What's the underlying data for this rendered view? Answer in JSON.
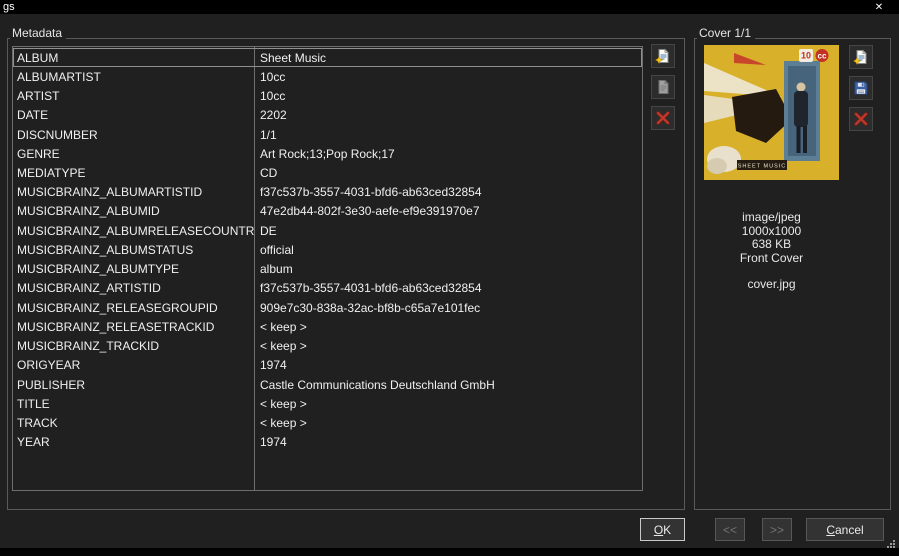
{
  "window": {
    "title": "gs",
    "close_icon": "✕"
  },
  "metadata": {
    "group_label": "Metadata",
    "rows": [
      {
        "field": "ALBUM",
        "value": "Sheet Music"
      },
      {
        "field": "ALBUMARTIST",
        "value": "10cc"
      },
      {
        "field": "ARTIST",
        "value": "10cc"
      },
      {
        "field": "DATE",
        "value": "2202"
      },
      {
        "field": "DISCNUMBER",
        "value": "1/1"
      },
      {
        "field": "GENRE",
        "value": "Art Rock;13;Pop Rock;17"
      },
      {
        "field": "MEDIATYPE",
        "value": "CD"
      },
      {
        "field": "MUSICBRAINZ_ALBUMARTISTID",
        "value": "f37c537b-3557-4031-bfd6-ab63ced32854"
      },
      {
        "field": "MUSICBRAINZ_ALBUMID",
        "value": "47e2db44-802f-3e30-aefe-ef9e391970e7"
      },
      {
        "field": "MUSICBRAINZ_ALBUMRELEASECOUNTRY",
        "value": "DE"
      },
      {
        "field": "MUSICBRAINZ_ALBUMSTATUS",
        "value": "official"
      },
      {
        "field": "MUSICBRAINZ_ALBUMTYPE",
        "value": "album"
      },
      {
        "field": "MUSICBRAINZ_ARTISTID",
        "value": "f37c537b-3557-4031-bfd6-ab63ced32854"
      },
      {
        "field": "MUSICBRAINZ_RELEASEGROUPID",
        "value": "909e7c30-838a-32ac-bf8b-c65a7e101fec"
      },
      {
        "field": "MUSICBRAINZ_RELEASETRACKID",
        "value": "< keep >"
      },
      {
        "field": "MUSICBRAINZ_TRACKID",
        "value": "< keep >"
      },
      {
        "field": "ORIGYEAR",
        "value": "1974"
      },
      {
        "field": "PUBLISHER",
        "value": "Castle Communications Deutschland GmbH"
      },
      {
        "field": "TITLE",
        "value": "< keep >"
      },
      {
        "field": "TRACK",
        "value": "< keep >"
      },
      {
        "field": "YEAR",
        "value": "1974"
      }
    ]
  },
  "cover": {
    "group_label": "Cover 1/1",
    "info_lines": [
      "image/jpeg",
      "1000x1000",
      "638 KB",
      "Front Cover"
    ],
    "filename": "cover.jpg",
    "art": {
      "logo_left": "10",
      "logo_right": "cc",
      "title_text": "SHEET MUSIC"
    }
  },
  "buttons": {
    "ok": "OK",
    "prev": "<<",
    "next": ">>",
    "cancel": "Cancel"
  },
  "icons": {
    "close": "✕",
    "add": "new-file",
    "copy": "file-gray",
    "save": "floppy-disk",
    "delete": "red-x"
  },
  "colors": {
    "dialog_bg": "#202020",
    "titlebar_bg": "#000000",
    "focus_border": "#c9c9c9",
    "delete_red": "#b5352a",
    "cover_yellow": "#d8b02a"
  }
}
